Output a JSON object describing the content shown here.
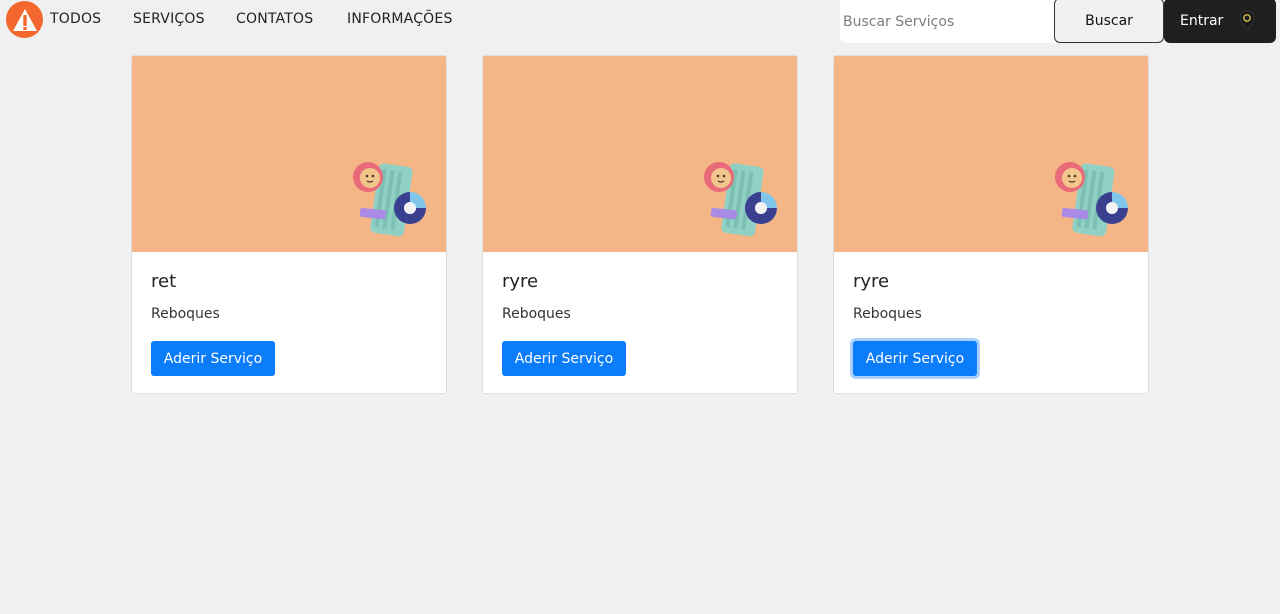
{
  "nav": {
    "logo_icon": "warning-triangle-icon",
    "links": [
      "TODOS",
      "SERVIÇOS",
      "CONTATOS",
      "INFORMAÇÕES"
    ],
    "search_placeholder": "Buscar Serviços",
    "search_value": "",
    "search_button": "Buscar",
    "login_button": "Entrar",
    "login_icon": "location-pin-icon"
  },
  "colors": {
    "logo": "#f4672f",
    "card_image_bg": "#f4b587",
    "primary_button": "#0b7cfa",
    "login_button_bg": "#1f1f1f"
  },
  "cards": [
    {
      "title": "ret",
      "subtitle": "Reboques",
      "button": "Aderir Serviço",
      "image_icon": "phone-analytics-illustration"
    },
    {
      "title": "ryre",
      "subtitle": "Reboques",
      "button": "Aderir Serviço",
      "image_icon": "phone-analytics-illustration"
    },
    {
      "title": "ryre",
      "subtitle": "Reboques",
      "button": "Aderir Serviço",
      "image_icon": "phone-analytics-illustration"
    }
  ]
}
